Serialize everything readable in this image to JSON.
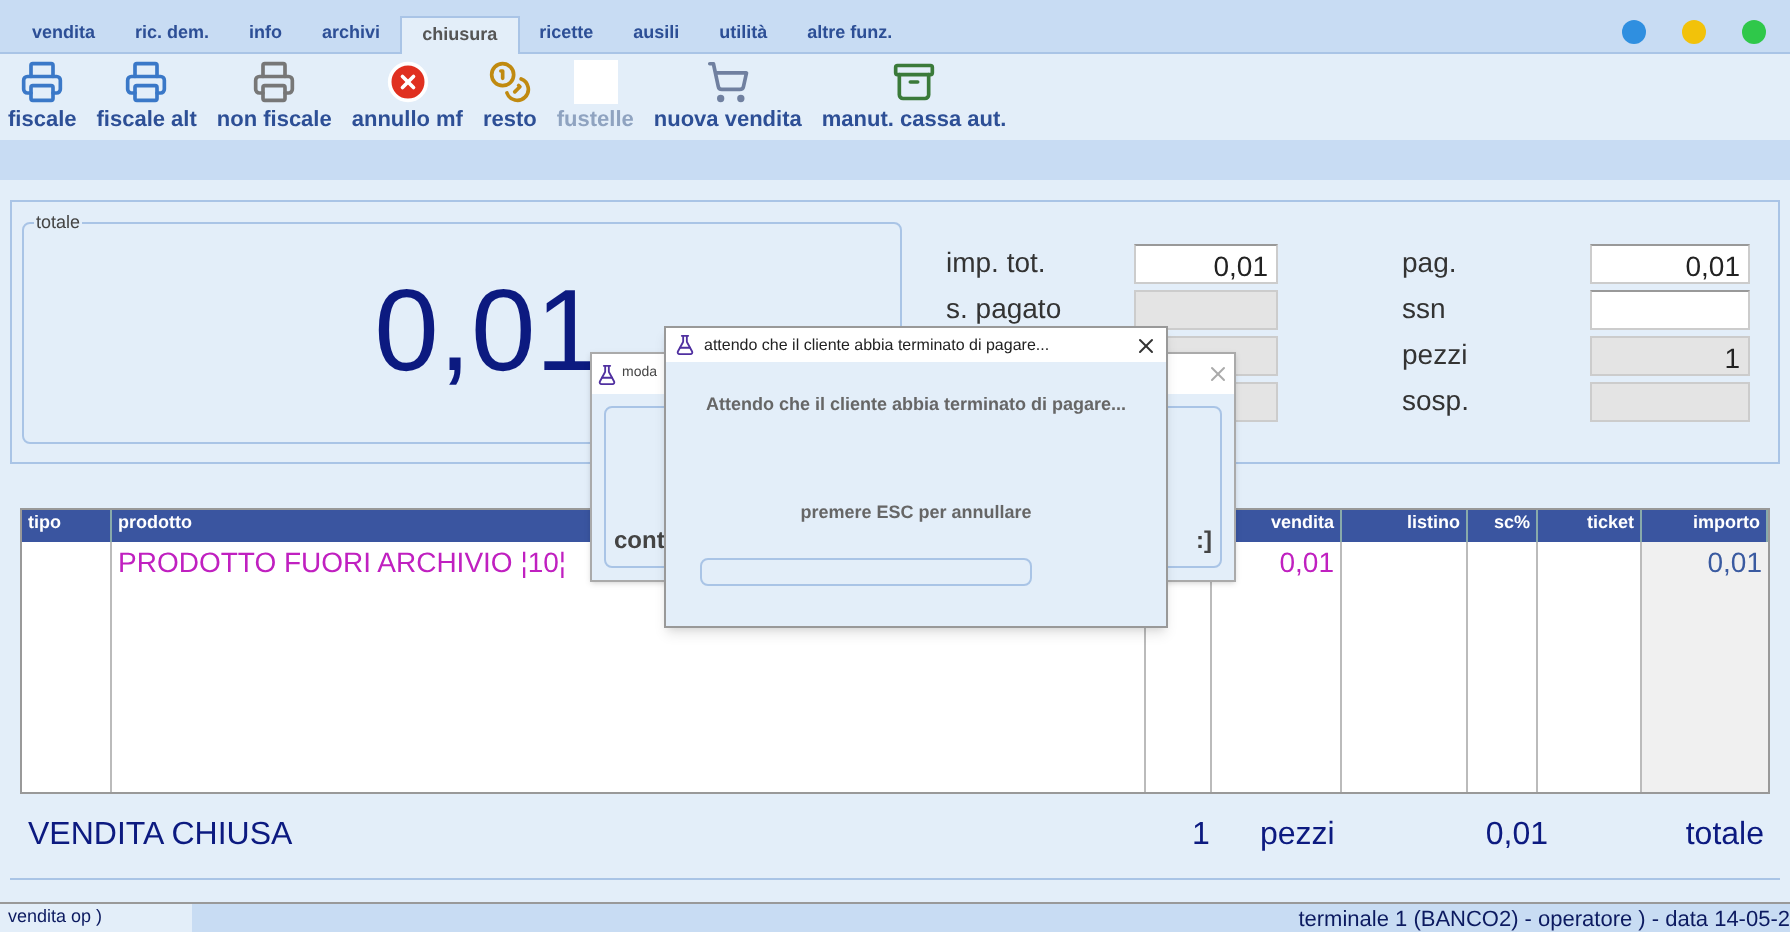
{
  "tabs": [
    {
      "label": "vendita",
      "selected": false
    },
    {
      "label": "ric. dem.",
      "selected": false
    },
    {
      "label": "info",
      "selected": false
    },
    {
      "label": "archivi",
      "selected": false
    },
    {
      "label": "chiusura",
      "selected": true
    },
    {
      "label": "ricette",
      "selected": false
    },
    {
      "label": "ausili",
      "selected": false
    },
    {
      "label": "utilità",
      "selected": false
    },
    {
      "label": "altre funz.",
      "selected": false
    }
  ],
  "toolbar": [
    {
      "label": "fiscale",
      "disabled": false
    },
    {
      "label": "fiscale alt",
      "disabled": false
    },
    {
      "label": "non fiscale",
      "disabled": false
    },
    {
      "label": "annullo mf",
      "disabled": false
    },
    {
      "label": "resto",
      "disabled": false
    },
    {
      "label": "fustelle",
      "disabled": true
    },
    {
      "label": "nuova vendita",
      "disabled": false
    },
    {
      "label": "manut. cassa aut.",
      "disabled": false
    }
  ],
  "total_panel": {
    "legend": "totale",
    "amount": "0,01"
  },
  "fields_left": [
    {
      "label": "imp. tot.",
      "value": "0,01",
      "editable": true
    },
    {
      "label": "s. pagato",
      "editable": false
    },
    {
      "editable": false
    },
    {
      "editable": false
    }
  ],
  "fields_right": [
    {
      "label": "pag.",
      "value": "0,01",
      "editable": true
    },
    {
      "label": "ssn",
      "editable": true
    },
    {
      "label": "pezzi",
      "value": "1",
      "editable": false
    },
    {
      "label": "sosp.",
      "editable": false
    }
  ],
  "table": {
    "columns": [
      "tipo",
      "prodotto",
      "vendita",
      "listino",
      "sc%",
      "ticket",
      "importo"
    ],
    "rows": [
      {
        "prodotto": "PRODOTTO FUORI ARCHIVIO ¦10¦",
        "vendita": "0,01",
        "importo": "0,01"
      }
    ]
  },
  "summary": {
    "status": "VENDITA CHIUSA",
    "count": "1",
    "count_label": "pezzi",
    "total": "0,01",
    "total_label": "totale"
  },
  "status_bar": {
    "left": "vendita op )",
    "right": "terminale 1 (BANCO2) - operatore ) - data 14-05-2"
  },
  "back_dialog": {
    "title": "moda",
    "text_left": "cont",
    "text_right": ":]"
  },
  "front_dialog": {
    "title": "attendo che il cliente abbia terminato di pagare...",
    "message": "Attendo che il cliente abbia terminato di pagare...",
    "hint": "premere ESC per annullare",
    "progress": {
      "level": 0
    }
  }
}
